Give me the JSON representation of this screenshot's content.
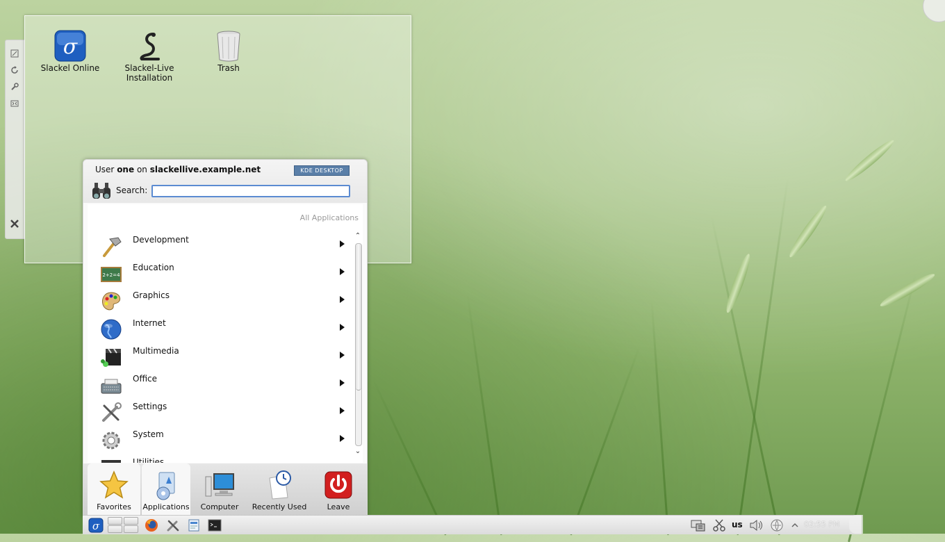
{
  "desktop": {
    "icons": [
      {
        "label": "Slackel Online"
      },
      {
        "label": "Slackel-Live\nInstallation"
      },
      {
        "label": "Trash"
      }
    ]
  },
  "kickoff": {
    "user_prefix": "User",
    "user_name": "one",
    "user_on": "on",
    "host": "slackellive.example.net",
    "badge": "KDE DESKTOP",
    "search_label": "Search:",
    "search_value": "",
    "section_label": "All Applications",
    "categories": [
      {
        "label": "Development",
        "icon": "hammer-icon"
      },
      {
        "label": "Education",
        "icon": "chalkboard-icon"
      },
      {
        "label": "Graphics",
        "icon": "palette-icon"
      },
      {
        "label": "Internet",
        "icon": "globe-icon"
      },
      {
        "label": "Multimedia",
        "icon": "clapperboard-icon"
      },
      {
        "label": "Office",
        "icon": "typewriter-icon"
      },
      {
        "label": "Settings",
        "icon": "tools-icon"
      },
      {
        "label": "System",
        "icon": "gear-icon"
      },
      {
        "label": "Utilities",
        "icon": "utilities-icon"
      }
    ],
    "tabs": [
      {
        "label": "Favorites",
        "icon": "star-icon"
      },
      {
        "label": "Applications",
        "icon": "applications-icon"
      },
      {
        "label": "Computer",
        "icon": "computer-icon"
      },
      {
        "label": "Recently Used",
        "icon": "clock-icon"
      },
      {
        "label": "Leave",
        "icon": "power-icon"
      }
    ],
    "active_tab": "Applications"
  },
  "taskbar": {
    "keyboard_layout": "us",
    "clock": "02:55 PM"
  }
}
